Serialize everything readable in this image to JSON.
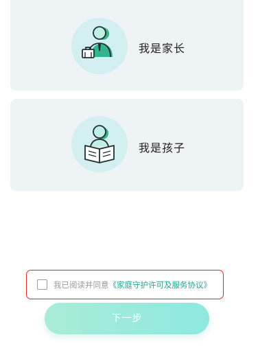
{
  "colors": {
    "card_bg": "#eef4f5",
    "avatar_bg": "#d4efef",
    "accent_teal": "#2aa38e",
    "button_gradient_start": "#a9ecd7",
    "button_gradient_end": "#8fe8e0",
    "highlight_border": "#e1262b"
  },
  "roles": {
    "parent": {
      "label": "我是家长",
      "icon": "parent-icon"
    },
    "child": {
      "label": "我是孩子",
      "icon": "child-reading-icon"
    }
  },
  "agreement": {
    "checked": false,
    "prefix": "我已阅读并同意",
    "link_text": "《家庭守护许可及服务协议》"
  },
  "next_button": {
    "label": "下一步",
    "enabled": false
  }
}
